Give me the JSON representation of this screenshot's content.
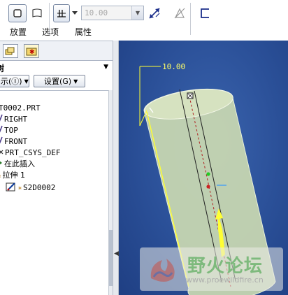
{
  "toolbar": {
    "placement_label": "放置",
    "options_label": "选项",
    "properties_label": "属性",
    "depth_value": "10.00"
  },
  "navigator": {
    "title": "树",
    "show_button": "示(Ⓘ)",
    "settings_button": "设置(G)",
    "tree": [
      {
        "label": "T0002.PRT",
        "icon": "part-icon"
      },
      {
        "label": "RIGHT",
        "icon": "datum-plane-icon"
      },
      {
        "label": "TOP",
        "icon": "datum-plane-icon"
      },
      {
        "label": "FRONT",
        "icon": "datum-plane-icon"
      },
      {
        "label": "PRT_CSYS_DEF",
        "icon": "csys-icon"
      },
      {
        "label": "在此插入",
        "icon": "insert-here-icon"
      },
      {
        "label": "拉伸 1",
        "icon": "extrude-icon"
      },
      {
        "label": "S2D0002",
        "icon": "sketch-icon"
      }
    ]
  },
  "graphics": {
    "dimension_label": "10.00"
  },
  "watermark": {
    "main": "野火论坛",
    "sub": "www.proewildfire.cn"
  },
  "colors": {
    "viewport_background": "#2a4f97",
    "model_fill": "#c9d8b2",
    "dimension_yellow": "#ffff33"
  }
}
